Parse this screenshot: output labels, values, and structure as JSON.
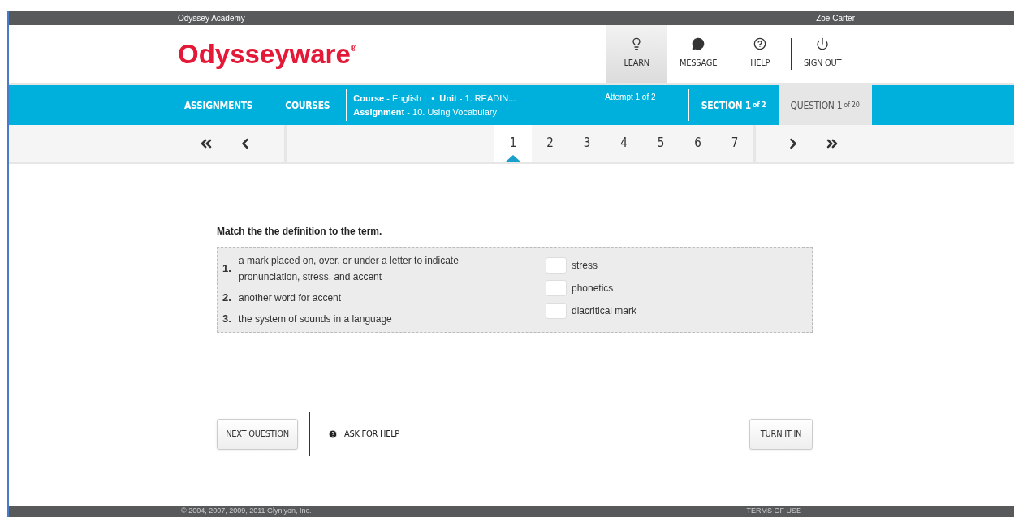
{
  "top_bar": {
    "school": "Odyssey Academy",
    "user": "Zoe Carter"
  },
  "logo": {
    "name": "Odysseyware",
    "mark": "®"
  },
  "header_nav": [
    {
      "label": "LEARN",
      "kind": "bulb",
      "selected": true
    },
    {
      "label": "MESSAGE",
      "kind": "chat",
      "selected": false
    },
    {
      "label": "HELP",
      "kind": "help",
      "selected": false
    },
    {
      "label": "SIGN OUT",
      "kind": "power",
      "selected": false
    }
  ],
  "main_nav": [
    "ASSIGNMENTS",
    "COURSES"
  ],
  "context": {
    "course_line": "**Course** - English I  •  **Unit** - 1. READIN...",
    "assignment_line": "**Assignment** - 10. Using Vocabulary",
    "attempt": "Attempt 1 of 2"
  },
  "section": {
    "label": "SECTION",
    "num": "1",
    "of": "of 2"
  },
  "question": {
    "label": "QUESTION",
    "num": "1",
    "of": "of 20"
  },
  "pages": [
    {
      "label": "1",
      "selected": true
    },
    {
      "label": "2",
      "selected": false
    },
    {
      "label": "3",
      "selected": false
    },
    {
      "label": "4",
      "selected": false
    },
    {
      "label": "5",
      "selected": false
    },
    {
      "label": "6",
      "selected": false
    },
    {
      "label": "7",
      "selected": false
    }
  ],
  "prompt": "Match the the definition to the term.",
  "definitions": [
    {
      "num": "1.",
      "text": "a mark placed on, over, or under a letter to indicate pronunciation, stress, and accent"
    },
    {
      "num": "2.",
      "text": "another word for accent"
    },
    {
      "num": "3.",
      "text": "the system of sounds in a language"
    }
  ],
  "terms": [
    {
      "term": "stress"
    },
    {
      "term": "phonetics"
    },
    {
      "term": "diacritical mark"
    }
  ],
  "buttons": {
    "next": "NEXT QUESTION",
    "help": "ASK FOR HELP",
    "turn_in": "TURN IT IN"
  },
  "footer": {
    "copyright": "© 2004, 2007, 2009, 2011 Glynlyon, Inc.",
    "terms": "TERMS OF USE"
  }
}
